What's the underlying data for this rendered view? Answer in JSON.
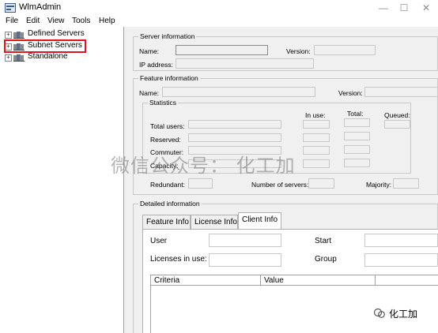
{
  "window": {
    "title": "WlmAdmin",
    "min_glyph": "—",
    "max_glyph": "☐",
    "close_glyph": "✕"
  },
  "menu": [
    "File",
    "Edit",
    "View",
    "Tools",
    "Help"
  ],
  "tree": {
    "items": [
      {
        "label": "Defined Servers",
        "expander": "+"
      },
      {
        "label": "Subnet Servers",
        "expander": "+",
        "highlighted": true
      },
      {
        "label": "Standalone",
        "expander": "+"
      }
    ],
    "highlight_color": "#e0141e"
  },
  "server_info": {
    "legend": "Server information",
    "name_label": "Name:",
    "version_label": "Version:",
    "ip_label": "IP address:"
  },
  "feature_info": {
    "legend": "Feature information",
    "name_label": "Name:",
    "version_label": "Version:",
    "statistics": {
      "legend": "Statistics",
      "in_use_header": "In use:",
      "total_header": "Total:",
      "queued_header": "Queued:",
      "rows": [
        "Total users:",
        "Reserved:",
        "Commuter:",
        "Capacity:"
      ],
      "redundant_label": "Redundant:",
      "num_servers_label": "Number of servers:",
      "majority_label": "Majority:"
    }
  },
  "detailed_info": {
    "legend": "Detailed information",
    "tabs": [
      "Feature Info",
      "License Info",
      "Client Info"
    ],
    "active_tab": "Client Info",
    "user_label": "User",
    "start_label": "Start",
    "licenses_label": "Licenses in use:",
    "group_label": "Group",
    "table_headers": [
      "Criteria",
      "Value"
    ]
  },
  "watermark": "微信公众号： 化工加",
  "wechat_badge": "化工加"
}
